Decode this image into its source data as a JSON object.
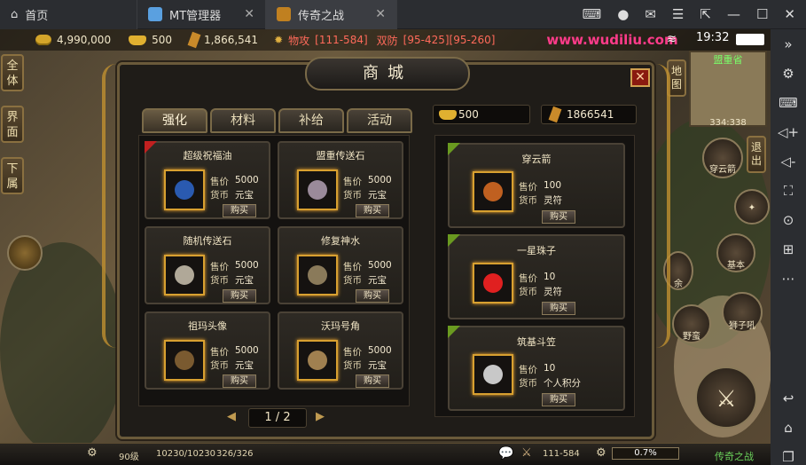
{
  "browser": {
    "tabs": [
      {
        "label": "首页"
      },
      {
        "label": "MT管理器"
      },
      {
        "label": "传奇之战"
      }
    ]
  },
  "status": {
    "gold": "4,990,000",
    "ingot": "500",
    "charm": "1,866,541",
    "attack_label": "物攻",
    "attack_value": "[111-584]",
    "defense_label": "双防",
    "defense_value": "[95-425][95-260]",
    "website": "www.wudiliu.com",
    "time": "19:32"
  },
  "left_buttons": [
    "全\n体",
    "界\n面",
    "下\n属"
  ],
  "shop": {
    "title": "商城",
    "close": "✕",
    "tabs": [
      "强化",
      "材料",
      "补给",
      "活动"
    ],
    "currency": {
      "ingot": "500",
      "charm": "1866541"
    },
    "price_label": "售价",
    "currency_label": "货币",
    "buy_label": "购买",
    "left_items": [
      {
        "name": "超级祝福油",
        "price": "5000",
        "currency": "元宝",
        "color": "#2a5ab0"
      },
      {
        "name": "盟重传送石",
        "price": "5000",
        "currency": "元宝",
        "color": "#9a8a9a"
      },
      {
        "name": "随机传送石",
        "price": "5000",
        "currency": "元宝",
        "color": "#b0a898"
      },
      {
        "name": "修复神水",
        "price": "5000",
        "currency": "元宝",
        "color": "#8a7a5a"
      },
      {
        "name": "祖玛头像",
        "price": "5000",
        "currency": "元宝",
        "color": "#7a5a30"
      },
      {
        "name": "沃玛号角",
        "price": "5000",
        "currency": "元宝",
        "color": "#a08050"
      }
    ],
    "right_items": [
      {
        "name": "穿云箭",
        "price": "100",
        "currency": "灵符",
        "color": "#c06020"
      },
      {
        "name": "一星珠子",
        "price": "10",
        "currency": "灵符",
        "color": "#e02020"
      },
      {
        "name": "筑基斗笠",
        "price": "10",
        "currency": "个人积分",
        "color": "#c8c8c8"
      }
    ],
    "page": "1 / 2"
  },
  "minimap": {
    "name": "盟重省",
    "coords": "334:338"
  },
  "right_buttons": [
    "地\n图",
    "退\n出"
  ],
  "skills": [
    "穿云箭",
    "基本",
    "野蛮",
    "狮子吼",
    "余"
  ],
  "bottom": {
    "level": "90级",
    "hp": "10230/10230",
    "mp": "326/326",
    "attack": "111-584",
    "exp": "0.7%",
    "brand": "传奇之战"
  }
}
